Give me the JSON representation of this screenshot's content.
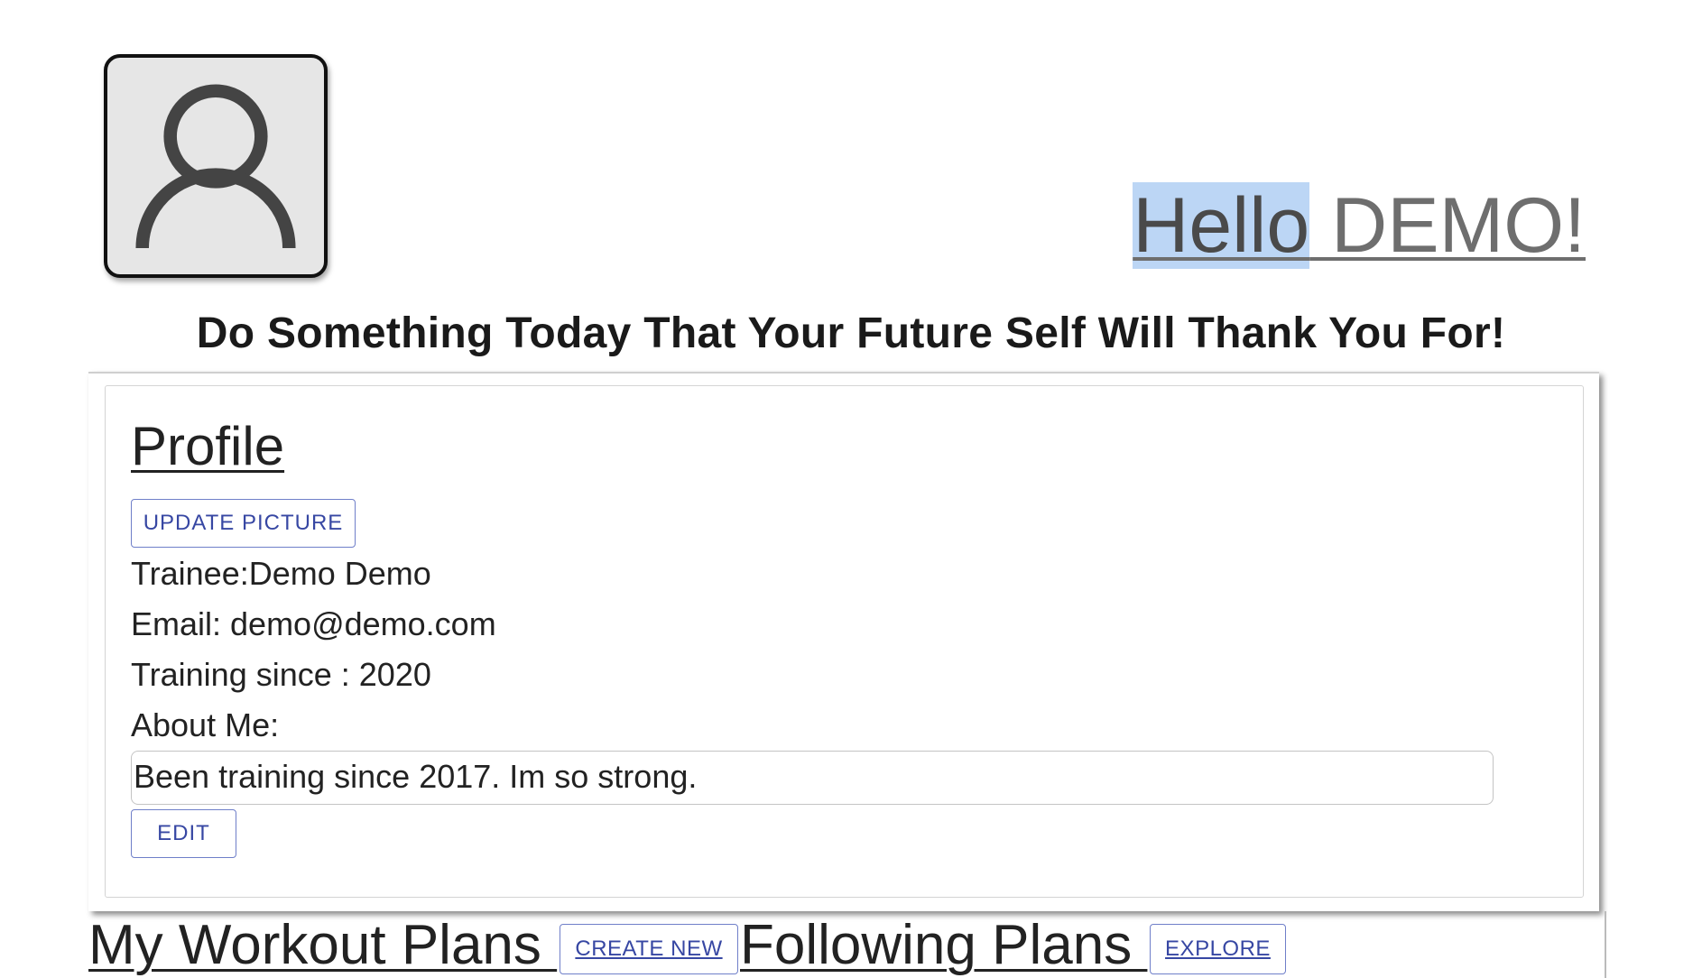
{
  "header": {
    "greeting_hello": "Hello",
    "greeting_name": " DEMO!",
    "motto": "Do Something Today That Your Future Self Will Thank You For!"
  },
  "profile": {
    "title": "Profile",
    "update_picture_label": "UPDATE PICTURE",
    "trainee": "Trainee:Demo Demo",
    "email": "Email: demo@demo.com",
    "training_since": "Training since : 2020",
    "about_label": "About Me:",
    "about_value": "Been training since 2017. Im so strong.",
    "edit_label": "EDIT"
  },
  "sections": {
    "workout_title": "My Workout Plans ",
    "create_new_label": "CREATE NEW",
    "following_title": "Following Plans ",
    "explore_label": "EXPLORE"
  },
  "colors": {
    "button_text": "#3747a3",
    "button_border": "#6f7fc9",
    "highlight": "#bcd6f5"
  }
}
